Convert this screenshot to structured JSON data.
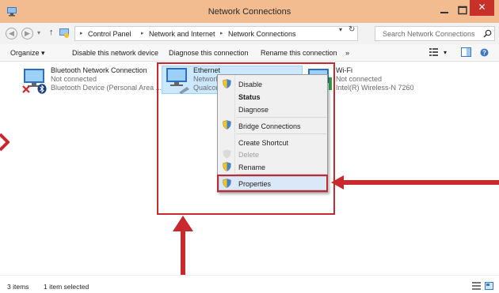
{
  "window": {
    "title": "Network Connections",
    "close_glyph": "✕"
  },
  "address": {
    "crumbs": [
      "Control Panel",
      "Network and Internet",
      "Network Connections"
    ],
    "search_placeholder": "Search Network Connections"
  },
  "toolbar": {
    "organize": "Organize ▾",
    "disable_device": "Disable this network device",
    "diagnose": "Diagnose this connection",
    "rename": "Rename this connection",
    "more": "»"
  },
  "items": [
    {
      "name": "Bluetooth Network Connection",
      "status": "Not connected",
      "device": "Bluetooth Device (Personal Area ..."
    },
    {
      "name": "Ethernet",
      "status": "Network",
      "device": "Qualcom"
    },
    {
      "name": "Wi-Fi",
      "status": "Not connected",
      "device": "Intel(R) Wireless-N 7260"
    }
  ],
  "context_menu": {
    "disable": "Disable",
    "status": "Status",
    "diagnose": "Diagnose",
    "bridge": "Bridge Connections",
    "create_shortcut": "Create Shortcut",
    "delete": "Delete",
    "rename": "Rename",
    "properties": "Properties"
  },
  "status": {
    "count": "3 items",
    "selected": "1 item selected"
  },
  "colors": {
    "annotation": "#c8292e",
    "titlebar": "#f2bb90",
    "selection": "#cce8ff",
    "close_button": "#c7312a"
  },
  "icons": [
    "app-network-icon",
    "minimize-icon",
    "maximize-icon",
    "close-icon",
    "back-icon",
    "forward-icon",
    "up-icon",
    "search-icon",
    "refresh-icon",
    "network-adapter-icon",
    "shield-icon",
    "bluetooth-icon",
    "disconnected-x-icon",
    "view-details-icon",
    "view-tiles-icon",
    "help-icon",
    "preview-pane-icon"
  ]
}
